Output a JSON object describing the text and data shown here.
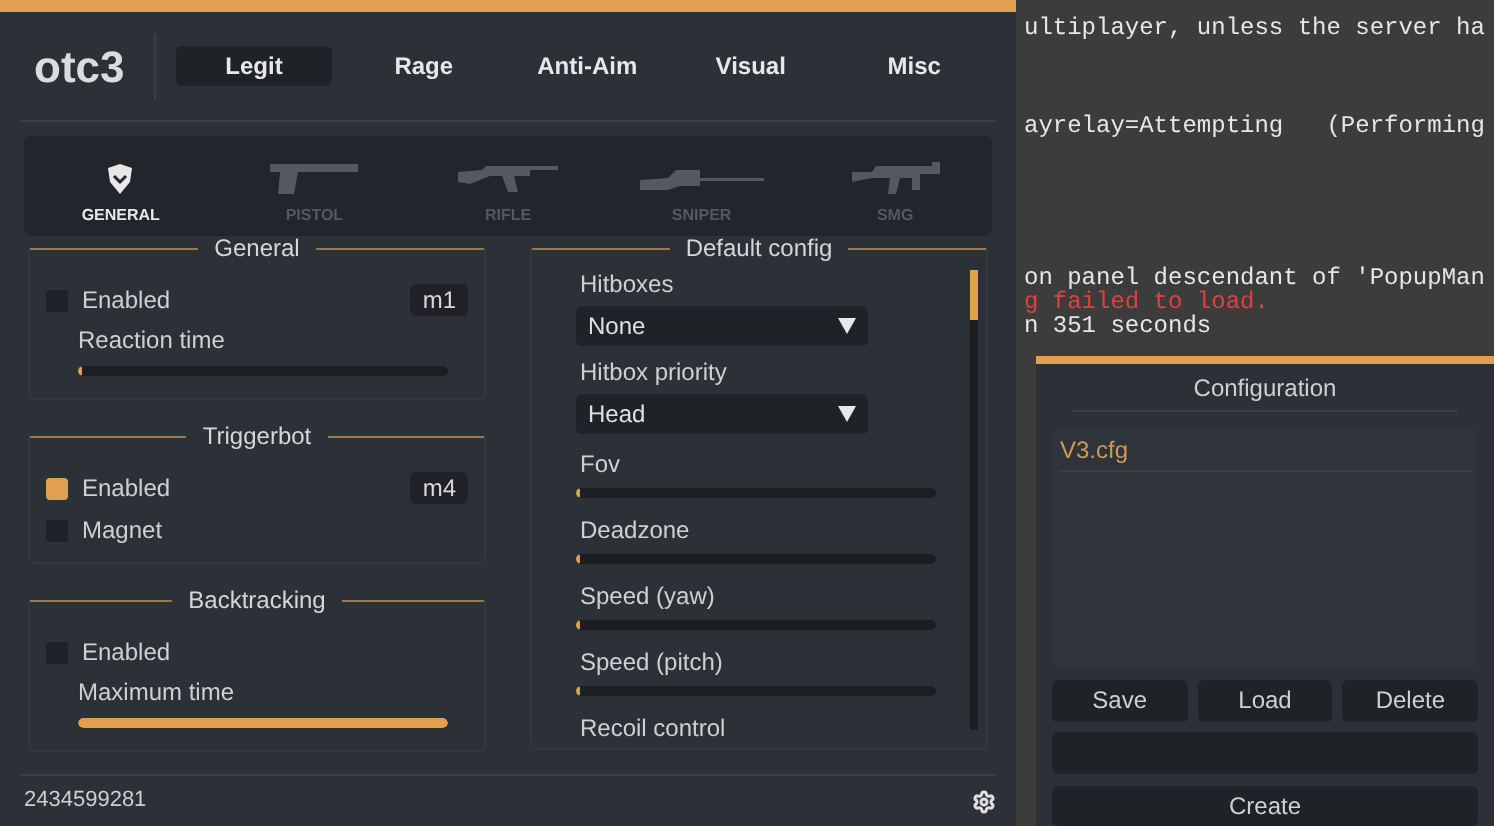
{
  "console": {
    "lines": [
      {
        "text": "ultiplayer, unless the server ha",
        "kind": "normal"
      },
      {
        "text": "ayrelay=Attempting   (Performing",
        "kind": "normal"
      },
      {
        "text": "on panel descendant of 'PopupMan",
        "kind": "normal"
      },
      {
        "text": "g failed to load.",
        "kind": "error"
      },
      {
        "text": "n 351 seconds",
        "kind": "normal"
      }
    ]
  },
  "main_window": {
    "logo": "otc3",
    "tabs": [
      {
        "label": "Legit",
        "selected": true
      },
      {
        "label": "Rage",
        "selected": false
      },
      {
        "label": "Anti-Aim",
        "selected": false
      },
      {
        "label": "Visual",
        "selected": false
      },
      {
        "label": "Misc",
        "selected": false
      }
    ],
    "weapons": [
      {
        "label": "GENERAL",
        "kind": "shield",
        "selected": true
      },
      {
        "label": "PISTOL",
        "kind": "pistol",
        "selected": false
      },
      {
        "label": "RIFLE",
        "kind": "rifle",
        "selected": false
      },
      {
        "label": "SNIPER",
        "kind": "sniper",
        "selected": false
      },
      {
        "label": "SMG",
        "kind": "smg",
        "selected": false
      }
    ],
    "groups": [
      {
        "title": "General",
        "items": [
          {
            "kind": "checkbox",
            "label": "Enabled",
            "checked": false,
            "key": "m1"
          },
          {
            "kind": "slider",
            "label": "Reaction time",
            "level": 0.01
          }
        ]
      },
      {
        "title": "Triggerbot",
        "items": [
          {
            "kind": "checkbox",
            "label": "Enabled",
            "checked": true,
            "key": "m4"
          },
          {
            "kind": "checkbox",
            "label": "Magnet",
            "checked": false
          }
        ]
      },
      {
        "title": "Backtracking",
        "items": [
          {
            "kind": "checkbox",
            "label": "Enabled",
            "checked": false
          },
          {
            "kind": "slider",
            "label": "Maximum time",
            "level": 1
          }
        ]
      }
    ],
    "default_config": {
      "title": "Default config",
      "items": [
        {
          "kind": "dropdown",
          "label": "Hitboxes",
          "value": "None"
        },
        {
          "kind": "dropdown",
          "label": "Hitbox priority",
          "value": "Head"
        },
        {
          "kind": "slider",
          "label": "Fov",
          "level": 0.01
        },
        {
          "kind": "slider",
          "label": "Deadzone",
          "level": 0.01
        },
        {
          "kind": "slider",
          "label": "Speed (yaw)",
          "level": 0.01
        },
        {
          "kind": "slider",
          "label": "Speed (pitch)",
          "level": 0.01
        },
        {
          "kind": "label",
          "label": "Recoil control"
        }
      ]
    },
    "footer": {
      "id": "2434599281"
    }
  },
  "config_window": {
    "title": "Configuration",
    "files": [
      {
        "name": "V3.cfg",
        "selected": true
      }
    ],
    "buttons": [
      "Save",
      "Load",
      "Delete"
    ],
    "create": "Create"
  }
}
